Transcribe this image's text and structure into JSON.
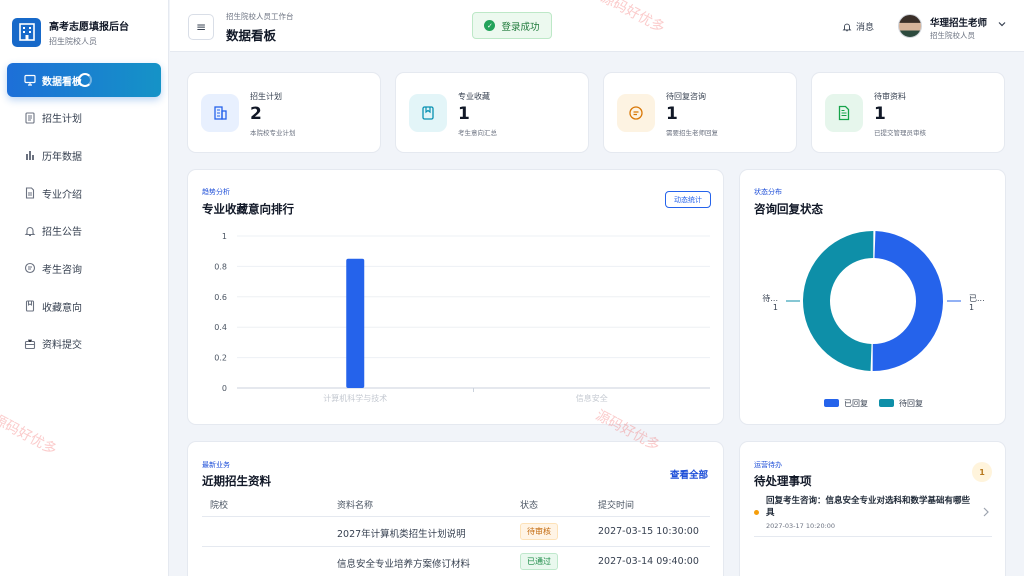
{
  "app": {
    "title": "高考志愿填报后台",
    "subtitle": "招生院校人员"
  },
  "sidebar": {
    "items": [
      {
        "label": "数据看板",
        "icon": "dashboard-icon",
        "active": true
      },
      {
        "label": "招生计划",
        "icon": "document-icon"
      },
      {
        "label": "历年数据",
        "icon": "bar-chart-icon"
      },
      {
        "label": "专业介绍",
        "icon": "file-icon"
      },
      {
        "label": "招生公告",
        "icon": "bell-icon"
      },
      {
        "label": "考生咨询",
        "icon": "chat-icon"
      },
      {
        "label": "收藏意向",
        "icon": "bookmark-icon"
      },
      {
        "label": "资料提交",
        "icon": "briefcase-icon"
      }
    ]
  },
  "header": {
    "breadcrumb": "招生院校人员工作台",
    "title": "数据看板",
    "toast": "登录成功",
    "messages": "消息",
    "user_name": "华理招生老师",
    "user_role": "招生院校人员"
  },
  "stats": [
    {
      "label": "招生计划",
      "value": "2",
      "note": "本院校专业计划",
      "icon": "building-icon",
      "color": "#2563eb",
      "bg": "#e8f0fe"
    },
    {
      "label": "专业收藏",
      "value": "1",
      "note": "考生意向汇总",
      "icon": "bookmark-icon",
      "color": "#0891b2",
      "bg": "#e3f5f8"
    },
    {
      "label": "待回复咨询",
      "value": "1",
      "note": "需要招生老师回复",
      "icon": "chat-icon",
      "color": "#d97706",
      "bg": "#fdf3e2"
    },
    {
      "label": "待审资料",
      "value": "1",
      "note": "已提交管理员审核",
      "icon": "document-icon",
      "color": "#16a34a",
      "bg": "#e6f6ec"
    }
  ],
  "trend": {
    "kicker": "趋势分析",
    "title": "专业收藏意向排行",
    "button": "动态统计"
  },
  "status": {
    "kicker": "状态分布",
    "title": "咨询回复状态",
    "left_label": "待...",
    "left_value": "1",
    "right_label": "已...",
    "right_value": "1"
  },
  "chart_data": [
    {
      "type": "bar",
      "categories": [
        "计算机科学与技术",
        "信息安全"
      ],
      "values": [
        0.85,
        0
      ],
      "ylim": [
        0,
        1
      ],
      "yticks": [
        "0",
        "0.2",
        "0.4",
        "0.6",
        "0.8",
        "1"
      ],
      "color": "#2563eb",
      "grid": true
    },
    {
      "type": "pie",
      "labels": [
        "已回复",
        "待回复"
      ],
      "values": [
        1,
        1
      ],
      "colors": [
        "#2563eb",
        "#0e8fa8"
      ],
      "legend": "bottom"
    }
  ],
  "recent": {
    "kicker": "最新业务",
    "title": "近期招生资料",
    "view_all": "查看全部",
    "columns": [
      "院校",
      "资料名称",
      "状态",
      "提交时间"
    ],
    "rows": [
      {
        "school": "",
        "name": "2027年计算机类招生计划说明",
        "status": "待审核",
        "status_kind": "pending",
        "time": "2027-03-15 10:30:00"
      },
      {
        "school": "",
        "name": "信息安全专业培养方案修订材料",
        "status": "已通过",
        "status_kind": "passed",
        "time": "2027-03-14 09:40:00"
      }
    ]
  },
  "todo": {
    "kicker": "运营待办",
    "title": "待处理事项",
    "count": "1",
    "items": [
      {
        "text": "回复考生咨询：信息安全专业对选科和数学基础有哪些具",
        "time": "2027-03-17 10:20:00"
      }
    ]
  },
  "watermark": "源码好优多"
}
